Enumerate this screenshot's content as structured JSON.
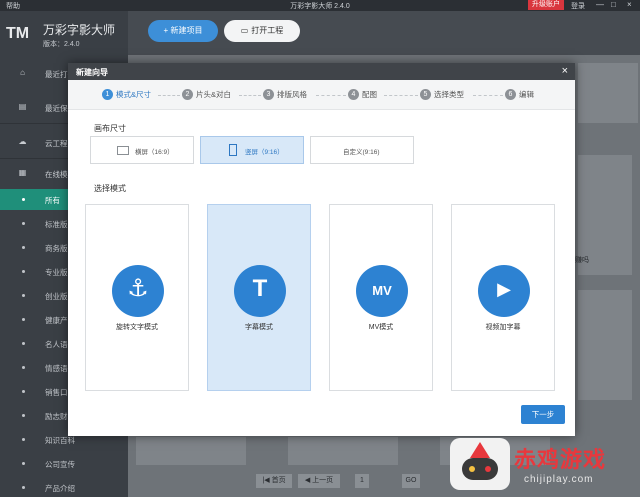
{
  "titlebar": {
    "menu_help": "帮助",
    "title": "万彩字影大师 2.4.0",
    "upgrade": "升级账户",
    "login": "登录",
    "minimize": "—",
    "maximize": "□",
    "close": "×"
  },
  "sidebar": {
    "logo": "TM",
    "app_name": "万彩字影大师",
    "version": "版本：2.4.0",
    "items": [
      {
        "label": "最近打开",
        "icon": "home-icon"
      },
      {
        "label": "最近保存",
        "icon": "save-icon"
      },
      {
        "label": "云工程",
        "icon": "cloud-icon"
      },
      {
        "label": "在线模板",
        "icon": "template-icon"
      }
    ],
    "sub_items": [
      {
        "label": "所有"
      },
      {
        "label": "标准版"
      },
      {
        "label": "商务版"
      },
      {
        "label": "专业版"
      },
      {
        "label": "创业版"
      },
      {
        "label": "健康产"
      },
      {
        "label": "名人语"
      },
      {
        "label": "情感语"
      },
      {
        "label": "销售口"
      },
      {
        "label": "励志财"
      },
      {
        "label": "知识百科"
      },
      {
        "label": "公司宣传"
      },
      {
        "label": "产品介绍"
      }
    ]
  },
  "toolbar": {
    "new_project": "+ 新建项目",
    "open_project": "打开工程"
  },
  "background": {
    "snippet": "赚吗",
    "pager": {
      "first": "|◀ 首页",
      "prev": "◀ 上一页",
      "page": "1",
      "go": "GO"
    }
  },
  "dialog": {
    "title": "新建向导",
    "close": "×",
    "steps": [
      {
        "num": "1",
        "label": "模式&尺寸"
      },
      {
        "num": "2",
        "label": "片头&对白"
      },
      {
        "num": "3",
        "label": "排版风格"
      },
      {
        "num": "4",
        "label": "配图"
      },
      {
        "num": "5",
        "label": "选择类型"
      },
      {
        "num": "6",
        "label": "编辑"
      }
    ],
    "canvas_size_title": "画布尺寸",
    "sizes": [
      {
        "label": "横屏（16:9）"
      },
      {
        "label": "竖屏（9:16）"
      },
      {
        "label": "自定义(9:16)"
      }
    ],
    "mode_title": "选择模式",
    "modes": [
      {
        "label": "旋转文字模式",
        "glyph": "⚓"
      },
      {
        "label": "字幕模式",
        "glyph": "T"
      },
      {
        "label": "MV模式",
        "glyph": "MV"
      },
      {
        "label": "视频加字幕",
        "glyph": "▶"
      }
    ],
    "next": "下一步"
  },
  "watermark": {
    "title": "赤鸡游戏",
    "url": "chijiplay.com"
  },
  "colors": {
    "accent": "#2d82d2",
    "sidebar_active": "#1f8f7a",
    "dialog_header": "#404449"
  }
}
